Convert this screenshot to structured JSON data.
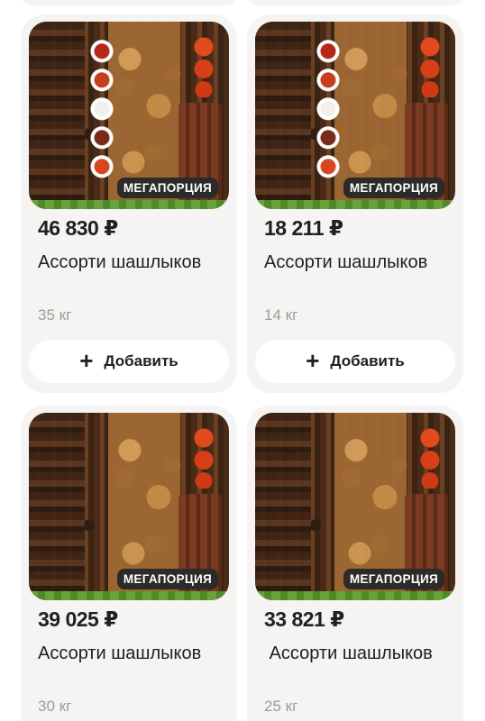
{
  "products": [
    {
      "price": "46 830 ₽",
      "title": "Ассорти шашлыков",
      "weight": "35 кг",
      "badge": "МЕГАПОРЦИЯ",
      "add_label": "Добавить"
    },
    {
      "price": "18 211 ₽",
      "title": "Ассорти шашлыков",
      "weight": "14 кг",
      "badge": "МЕГАПОРЦИЯ",
      "add_label": "Добавить"
    },
    {
      "price": "39 025 ₽",
      "title": "Ассорти шашлыков",
      "weight": "30 кг",
      "badge": "МЕГАПОРЦИЯ"
    },
    {
      "price": "33 821 ₽",
      "title": " Ассорти шашлыков",
      "weight": "25 кг",
      "badge": "МЕГАПОРЦИЯ"
    }
  ],
  "icons": {
    "add": "plus-icon"
  },
  "colors": {
    "card_bg": "#f5f4f2",
    "badge_bg": "#2c2b29",
    "text": "#21201f",
    "muted": "#9e9b98"
  }
}
